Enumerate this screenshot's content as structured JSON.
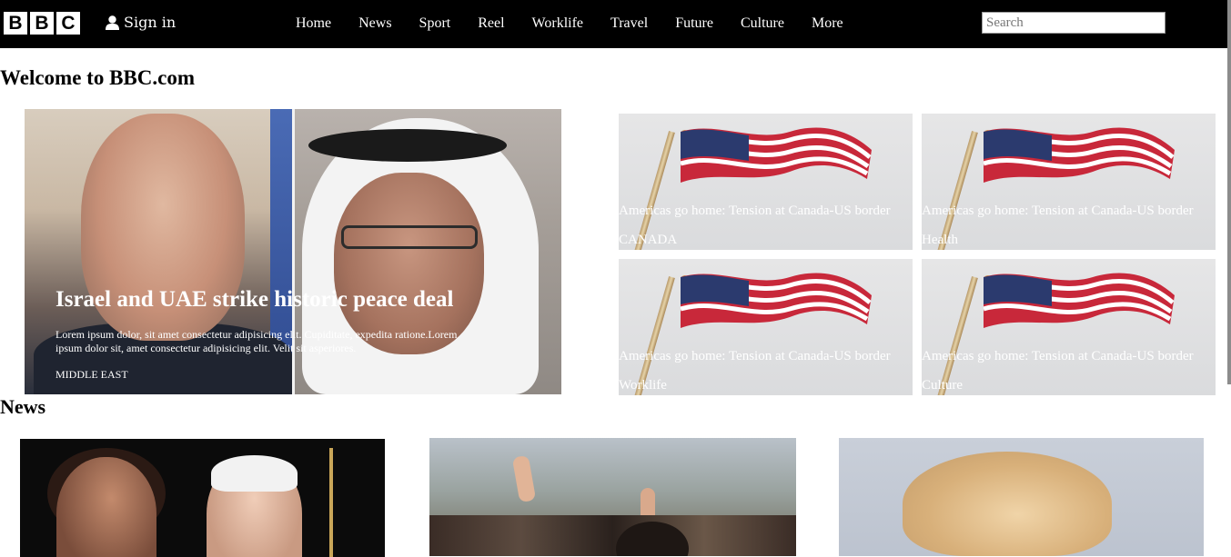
{
  "header": {
    "logo_letters": [
      "B",
      "B",
      "C"
    ],
    "signin_label": "Sign in",
    "nav": [
      "Home",
      "News",
      "Sport",
      "Reel",
      "Worklife",
      "Travel",
      "Future",
      "Culture",
      "More"
    ],
    "search_placeholder": "Search"
  },
  "welcome_title": "Welcome to BBC.com",
  "hero": {
    "headline": "Israel and UAE strike historic peace deal",
    "summary": "Lorem ipsum dolor, sit amet consectetur adipisicing elit. Cupiditate, expedita ratione.Lorem ipsum dolor sit, amet consectetur adipisicing elit. Velit sit asperiores.",
    "tag": "MIDDLE EAST"
  },
  "side_cards": [
    {
      "title": "Americas go home: Tension at Canada-US border",
      "tag": "CANADA"
    },
    {
      "title": "Americas go home: Tension at Canada-US border",
      "tag": "Health"
    },
    {
      "title": "Americas go home: Tension at Canada-US border",
      "tag": "Worklife"
    },
    {
      "title": "Americas go home: Tension at Canada-US border",
      "tag": "Culture"
    }
  ],
  "news_heading": "News",
  "colors": {
    "topbar": "#000000",
    "text_on_dark": "#ffffff",
    "background": "#ffffff"
  }
}
